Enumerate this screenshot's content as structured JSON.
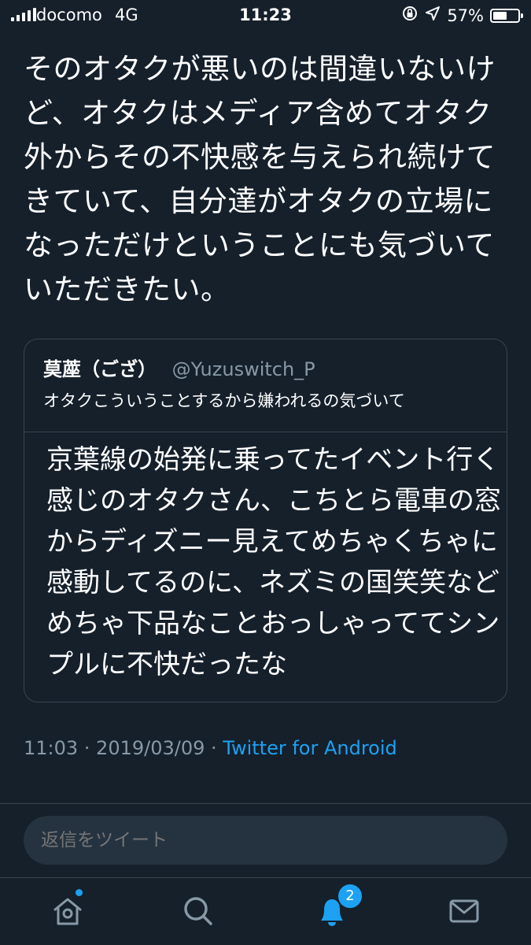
{
  "status_bar": {
    "carrier": "docomo",
    "network": "4G",
    "time": "11:23",
    "battery_text": "57%",
    "battery_level": 0.57
  },
  "tweet": {
    "text": "そのオタクが悪いのは間違いないけど、オタクはメディア含めてオタク外からその不快感を与えられ続けてきていて、自分達がオタクの立場になっただけということにも気づいていただきたい。",
    "timestamp": "11:03 · 2019/03/09 · ",
    "source": "Twitter for Android"
  },
  "quote": {
    "name": "莫蓙（ござ）",
    "handle": "@Yuzuswitch_P",
    "snippet": "オタクこういうことするから嫌われるの気づいて",
    "body": "京葉線の始発に乗ってたイベント行く感じのオタクさん、こちとら電車の窓からディズニー見えてめちゃくちゃに感動してるのに、ネズミの国笑笑などめちゃ下品なことおっしゃっててシンプルに不快だったな"
  },
  "reply": {
    "placeholder": "返信をツイート"
  },
  "tabbar": {
    "items": [
      "home-icon",
      "search-icon",
      "notifications-icon",
      "messages-icon"
    ],
    "notifications_badge": "2",
    "accent": "#1da1f2",
    "icon_color": "#8899a6"
  }
}
